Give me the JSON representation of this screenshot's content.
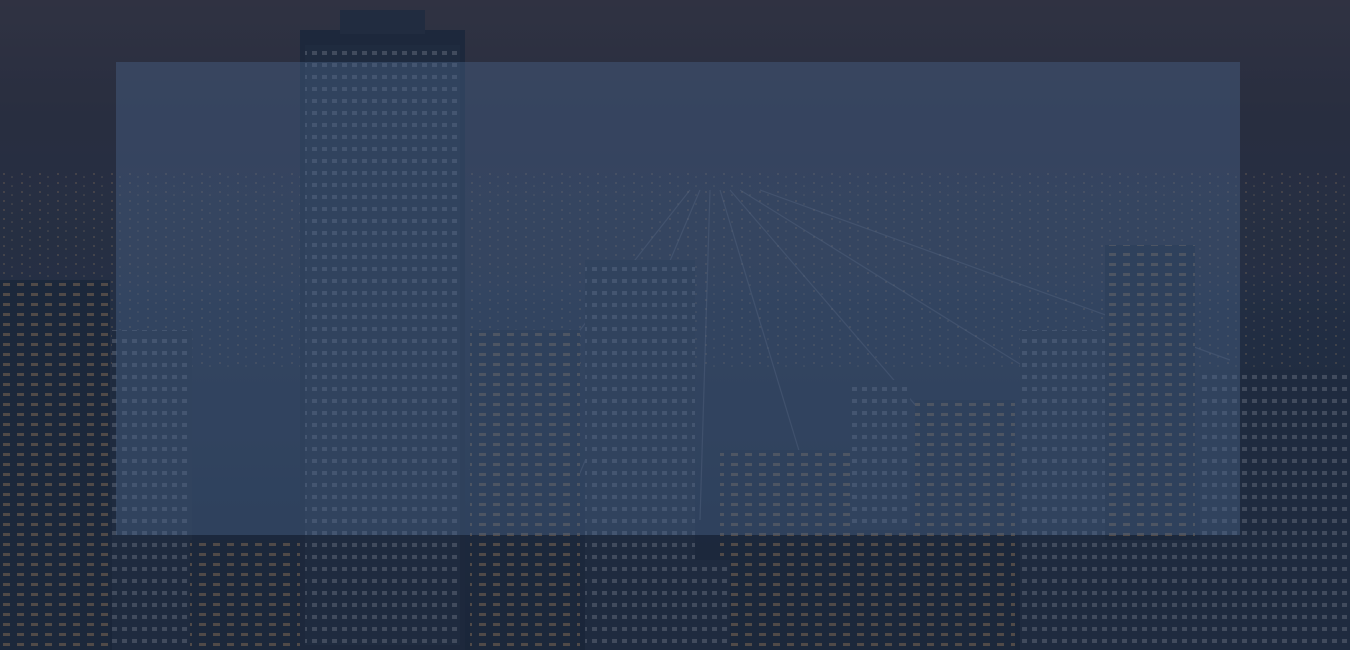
{
  "page": {
    "background_image": "night-city-skyline",
    "overlay_panel": "empty-translucent-panel"
  },
  "colors": {
    "sky_top": "#3a3642",
    "sky_bottom": "#1b2436",
    "overlay_tint": "#1c2a42",
    "panel_fill": "#4a648a",
    "city_lights": "#c9a06a"
  }
}
